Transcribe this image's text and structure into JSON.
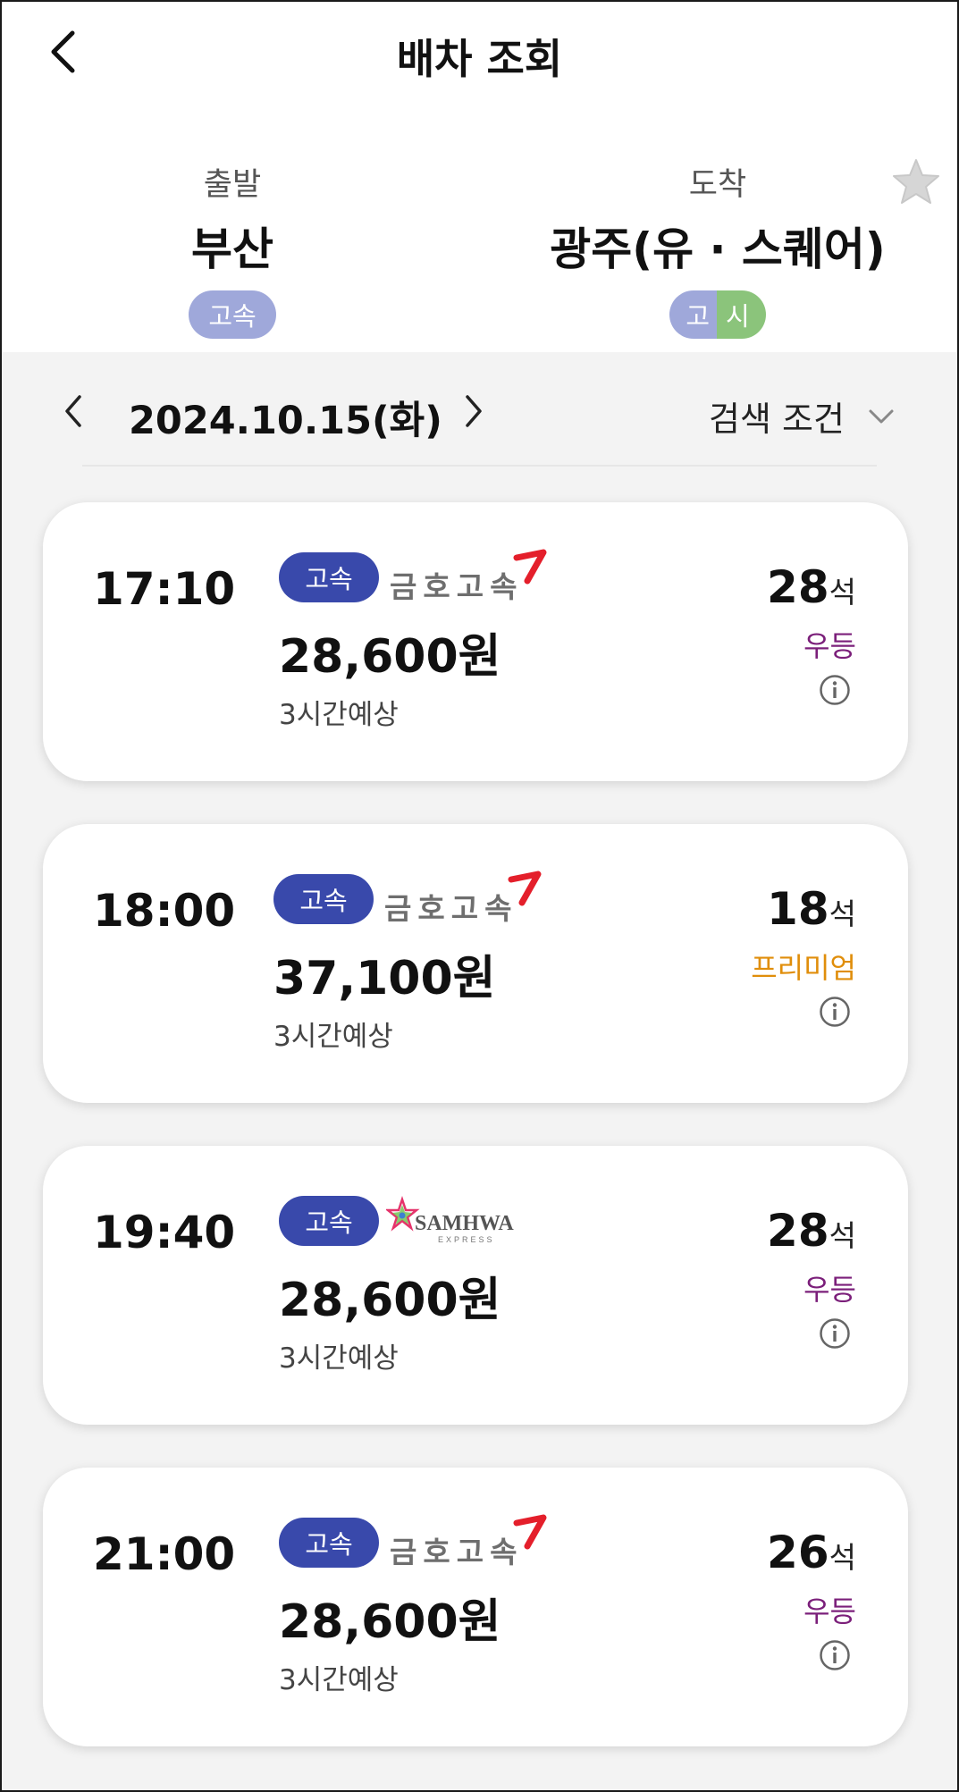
{
  "header": {
    "title": "배차 조회",
    "back_icon": "chevron-left-icon"
  },
  "route": {
    "departure": {
      "label": "출발",
      "city": "부산",
      "tag": "고속"
    },
    "arrival": {
      "label": "도착",
      "city": "광주(유 · 스퀘어)",
      "tags": [
        "고",
        "시"
      ]
    },
    "favorite_icon": "star-icon"
  },
  "date_bar": {
    "date": "2024.10.15(화)",
    "filter_label": "검색 조건"
  },
  "colors": {
    "badge": "#3949ab",
    "premium": "#e08e0b",
    "standard": "#7b1f7a",
    "departure_tag": "#9fa8da",
    "city_tag": "#8bc47b"
  },
  "schedules": [
    {
      "time": "17:10",
      "badge": "고속",
      "company": "금호고속",
      "price": "28,600원",
      "duration": "3시간예상",
      "seats": "28",
      "seat_unit": "석",
      "grade": "우등"
    },
    {
      "time": "18:00",
      "badge": "고속",
      "company": "금호고속",
      "price": "37,100원",
      "duration": "3시간예상",
      "seats": "18",
      "seat_unit": "석",
      "grade": "프리미엄"
    },
    {
      "time": "19:40",
      "badge": "고속",
      "company": "SAMHWA",
      "company_sub": "EXPRESS",
      "price": "28,600원",
      "duration": "3시간예상",
      "seats": "28",
      "seat_unit": "석",
      "grade": "우등"
    },
    {
      "time": "21:00",
      "badge": "고속",
      "company": "금호고속",
      "price": "28,600원",
      "duration": "3시간예상",
      "seats": "26",
      "seat_unit": "석",
      "grade": "우등"
    }
  ]
}
